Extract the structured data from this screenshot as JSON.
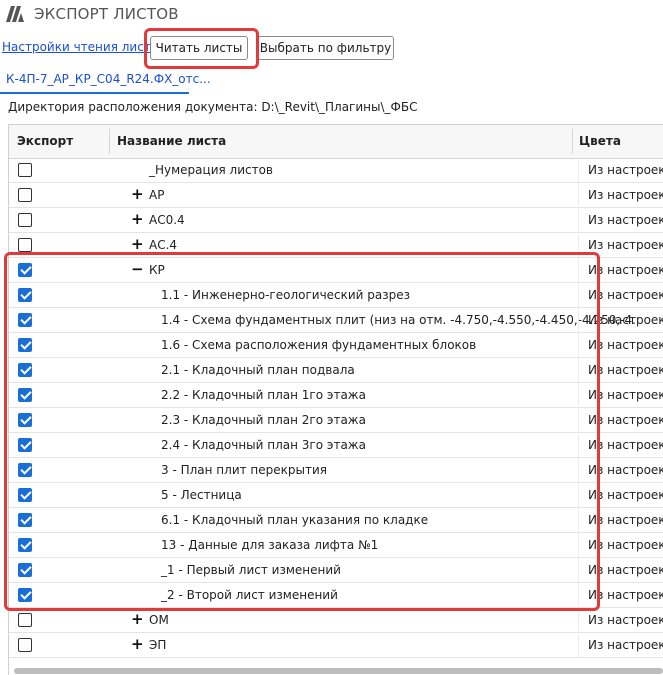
{
  "app": {
    "title": "ЭКСПОРТ ЛИСТОВ",
    "logo_icon": "brand-logo-icon"
  },
  "toolbar": {
    "read_settings_link": "Настройки чтения листов",
    "read_sheets_label": "Читать листы",
    "filter_label": "Выбрать по фильтру"
  },
  "document": {
    "tab_label": "К-4П-7_АР_КР_С04_R24.ФХ_отс...",
    "directory_label": "Директория расположения документа: D:\\_Revit\\_Плагины\\_ФБС"
  },
  "grid": {
    "columns": {
      "export": "Экспорт",
      "sheet_name": "Название листа",
      "colors": "Цвета"
    },
    "rows": [
      {
        "checked": false,
        "expander": "",
        "level": 0,
        "name": "_Нумерация листов",
        "colors": "Из настроек"
      },
      {
        "checked": false,
        "expander": "+",
        "level": 0,
        "name": "АР",
        "colors": "Из настроек"
      },
      {
        "checked": false,
        "expander": "+",
        "level": 0,
        "name": "АС0.4",
        "colors": "Из настроек"
      },
      {
        "checked": false,
        "expander": "+",
        "level": 0,
        "name": "АС.4",
        "colors": "Из настроек"
      },
      {
        "checked": true,
        "expander": "−",
        "level": 0,
        "name": "КР",
        "colors": "Из настроек"
      },
      {
        "checked": true,
        "expander": "",
        "level": 1,
        "name": "1.1 - Инженерно-геологический разрез",
        "colors": "Из настроек"
      },
      {
        "checked": true,
        "expander": "",
        "level": 1,
        "name": "1.4 - Схема фундаментных плит (низ на отм. -4.750,-4.550,-4.450,-4.250,-4.",
        "colors": "Из настроек"
      },
      {
        "checked": true,
        "expander": "",
        "level": 1,
        "name": "1.6 - Схема расположения фундаментных блоков",
        "colors": "Из настроек"
      },
      {
        "checked": true,
        "expander": "",
        "level": 1,
        "name": "2.1 - Кладочный план подвала",
        "colors": "Из настроек"
      },
      {
        "checked": true,
        "expander": "",
        "level": 1,
        "name": "2.2 - Кладочный план 1го этажа",
        "colors": "Из настроек"
      },
      {
        "checked": true,
        "expander": "",
        "level": 1,
        "name": "2.3 - Кладочный план 2го этажа",
        "colors": "Из настроек"
      },
      {
        "checked": true,
        "expander": "",
        "level": 1,
        "name": "2.4 - Кладочный план 3го этажа",
        "colors": "Из настроек"
      },
      {
        "checked": true,
        "expander": "",
        "level": 1,
        "name": "3 - План плит перекрытия",
        "colors": "Из настроек"
      },
      {
        "checked": true,
        "expander": "",
        "level": 1,
        "name": "5 - Лестница",
        "colors": "Из настроек"
      },
      {
        "checked": true,
        "expander": "",
        "level": 1,
        "name": "6.1 - Кладочный план указания по кладке",
        "colors": "Из настроек"
      },
      {
        "checked": true,
        "expander": "",
        "level": 1,
        "name": "13 - Данные для заказа лифта №1",
        "colors": "Из настроек"
      },
      {
        "checked": true,
        "expander": "",
        "level": 1,
        "name": "_1 - Первый лист изменений",
        "colors": "Из настроек"
      },
      {
        "checked": true,
        "expander": "",
        "level": 1,
        "name": "_2 - Второй лист изменений",
        "colors": "Из настроек"
      },
      {
        "checked": false,
        "expander": "+",
        "level": 0,
        "name": "ОМ",
        "colors": "Из настроек"
      },
      {
        "checked": false,
        "expander": "+",
        "level": 0,
        "name": "ЭП",
        "colors": "Из настроек"
      }
    ]
  },
  "highlight_color": "#e03a3a",
  "accent_color": "#1a6fd6"
}
